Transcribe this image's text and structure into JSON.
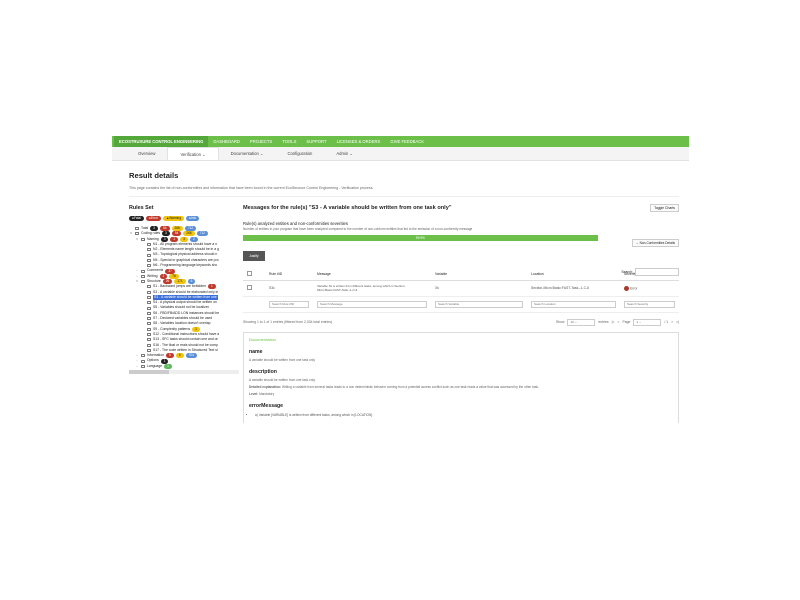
{
  "topbar": {
    "brand": "ECOSTRUXURE CONTROL ENGINEERING",
    "items": [
      "DASHBOARD",
      "PROJECTS",
      "TOOLS",
      "SUPPORT",
      "LICENSES & ORDERS",
      "GIVE FEEDBACK"
    ]
  },
  "subnav": {
    "items": [
      "Overview",
      "Verification ⌄",
      "Documentation ⌄",
      "Configuration",
      "Admin ⌄"
    ],
    "active_index": 1
  },
  "page": {
    "title": "Result details",
    "intro": "This page contains the list of non-conformities and information that have been found in the current EcoStruxure Control Engineering - Verification process."
  },
  "rules": {
    "title": "Rules Set",
    "legend": [
      "Fatal",
      "Error",
      "Warning",
      "Info"
    ],
    "tree": [
      {
        "indent": 0,
        "label": "Total",
        "badges": [
          {
            "c": "dark",
            "t": "3"
          },
          {
            "c": "red",
            "t": "54"
          },
          {
            "c": "yel",
            "t": "266"
          },
          {
            "c": "blue",
            "t": "712"
          }
        ]
      },
      {
        "indent": 0,
        "label": "Coding rules",
        "tw": "▾",
        "badges": [
          {
            "c": "dark",
            "t": "3"
          },
          {
            "c": "red",
            "t": "54"
          },
          {
            "c": "yel",
            "t": "266"
          },
          {
            "c": "blue",
            "t": "712"
          }
        ]
      },
      {
        "indent": 1,
        "label": "Naming",
        "tw": "▾",
        "badges": [
          {
            "c": "dark",
            "t": "3"
          },
          {
            "c": "red",
            "t": "2"
          },
          {
            "c": "yel",
            "t": "3"
          },
          {
            "c": "blue",
            "t": "2"
          }
        ]
      },
      {
        "indent": 2,
        "label": "N1 - All program elements should have a n"
      },
      {
        "indent": 2,
        "label": "N2 - Elements name length should be in a g"
      },
      {
        "indent": 2,
        "label": "N3 - Topological physical address should n"
      },
      {
        "indent": 2,
        "label": "N5 - Special or graphical characters are pro"
      },
      {
        "indent": 2,
        "label": "N6 - Programming language keywords sho"
      },
      {
        "indent": 1,
        "label": "Comments",
        "tw": "›",
        "badges": [
          {
            "c": "red",
            "t": "37"
          }
        ]
      },
      {
        "indent": 1,
        "label": "Writing",
        "tw": "›",
        "badges": [
          {
            "c": "red",
            "t": "2"
          },
          {
            "c": "yel",
            "t": "78"
          }
        ]
      },
      {
        "indent": 1,
        "label": "Structure",
        "tw": "▾",
        "badges": [
          {
            "c": "red",
            "t": "26"
          },
          {
            "c": "yel",
            "t": "171"
          },
          {
            "c": "blue",
            "t": "5"
          }
        ]
      },
      {
        "indent": 2,
        "label": "S1 - Backward jumps are forbidden",
        "badges": [
          {
            "c": "red",
            "t": "1"
          }
        ]
      },
      {
        "indent": 2,
        "label": "S3 - A variable should be elaborated only in"
      },
      {
        "indent": 2,
        "label": "S3 - A variable should be written from one",
        "sel": true
      },
      {
        "indent": 2,
        "label": "S4 - A physical output should be written on"
      },
      {
        "indent": 2,
        "label": "S5 - Variables should not be localized"
      },
      {
        "indent": 2,
        "label": "S6 - FBD/FB/ADD LON instances should be"
      },
      {
        "indent": 2,
        "label": "S7 - Declared variables should be used"
      },
      {
        "indent": 2,
        "label": "S8 - Variables location doesn't overlap"
      },
      {
        "indent": 2,
        "label": "S9 - Complexity patterns",
        "badges": [
          {
            "c": "yel",
            "t": "1"
          }
        ]
      },
      {
        "indent": 2,
        "label": "S12 - Conditional instructions should have a"
      },
      {
        "indent": 2,
        "label": "S13 - SFC tasks should contain one and on"
      },
      {
        "indent": 2,
        "label": "S16 - The float or reals should not be comp"
      },
      {
        "indent": 2,
        "label": "S17 - The code written in Structured Text sl"
      },
      {
        "indent": 1,
        "label": "Information",
        "tw": "›",
        "badges": [
          {
            "c": "red",
            "t": "5"
          },
          {
            "c": "yel",
            "t": "6"
          },
          {
            "c": "blue",
            "t": "704"
          }
        ]
      },
      {
        "indent": 1,
        "label": "Options",
        "tw": "›",
        "badges": [
          {
            "c": "dark",
            "t": "1"
          }
        ]
      },
      {
        "indent": 1,
        "label": "Language",
        "tw": "›",
        "badges": [
          {
            "c": "green",
            "t": "1"
          }
        ]
      }
    ]
  },
  "messages": {
    "title": "Messages for the rule(s) \"S3 - A variable should be written from one task only\"",
    "toggle_label": "Toggle Charts",
    "sub1": "Rule(s) analyzed entities and non-conformities severities",
    "sub2": "Number of entities in your program that have been analyzed compared to the number of non-conform entities that led to the emission of a non-conformity message",
    "progress_label": "99.9%",
    "progress_value": 0.999,
    "ncd_label": "Non-Conformities Details",
    "justify_label": "Justify",
    "search_label": "Search:",
    "columns": [
      "",
      "Rule #ID",
      "Message",
      "Variable",
      "Location",
      "Severity"
    ],
    "rows": [
      {
        "id": "S3c",
        "message": "Variable Xk is written from different tasks, among which in Section-Micro:Basic:FAST-Task--1-C-6",
        "variable": "Xk",
        "location": "Section-Micro:Basic:FAST-Task--1-C-6",
        "severity": "Error"
      }
    ],
    "filters": [
      "Search Rule #ID",
      "Search Message",
      "Search Variable",
      "Search Location",
      "Search Severity"
    ],
    "info": "Showing 1 to 1 of 1 entries (filtered from 2,034 total entries)",
    "show_label": "Show",
    "show_value": "10",
    "entries_label": "entries",
    "page_label": "Page",
    "page_value": "1",
    "page_total": "/ 1"
  },
  "documentation": {
    "title": "Documentation",
    "name_key": "name",
    "name_value": "A variable should be written from one task only",
    "desc_key": "description",
    "desc_value": "A variable should be written from one task only.",
    "detailed_label": "Detailed explanation:",
    "detailed_value": "Writing a variable from several tasks leads to a non deterministic behavior coming from a potential access conflict such as one task reads a value that was accessed by the other task.",
    "level_label": "Level:",
    "level_value": "Mandatory",
    "err_key": "errorMessage",
    "err_value": "a) Variable [VARIABLE] is written from different tasks, among which in [LOCATION]"
  }
}
